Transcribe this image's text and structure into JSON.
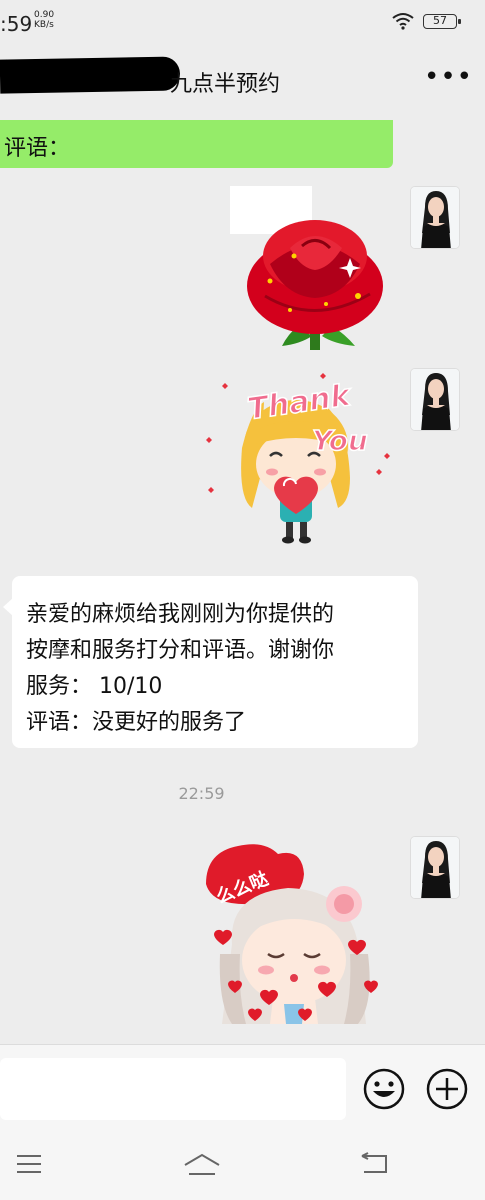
{
  "status_bar": {
    "time": ":59",
    "speed_value": "0.90",
    "speed_unit": "KB/s",
    "battery": "57"
  },
  "header": {
    "title": "九点半预约",
    "more_icon": "more-icon"
  },
  "messages": {
    "green_bubble_text": "评语：",
    "review_request": {
      "line1": "亲爱的麻烦给我刚刚为你提供的",
      "line2": "按摩和服务打分和评语。谢谢你",
      "line3": "服务：  10/10",
      "line4": "评语：没更好的服务了"
    },
    "timestamp": "22:59",
    "stickers": {
      "thank_you_line1": "Thank",
      "thank_you_line2": "You",
      "kiss_text": "么么哒"
    }
  },
  "input_bar": {
    "emoji_icon": "emoji-icon",
    "add_icon": "plus-icon"
  },
  "nav_bar": {
    "menu_icon": "menu-icon",
    "home_icon": "home-icon",
    "back_icon": "back-icon"
  },
  "colors": {
    "chat_background": "#ededed",
    "sent_bubble": "#95ec69",
    "received_bubble": "#ffffff",
    "timestamp": "#9a9a9a"
  }
}
